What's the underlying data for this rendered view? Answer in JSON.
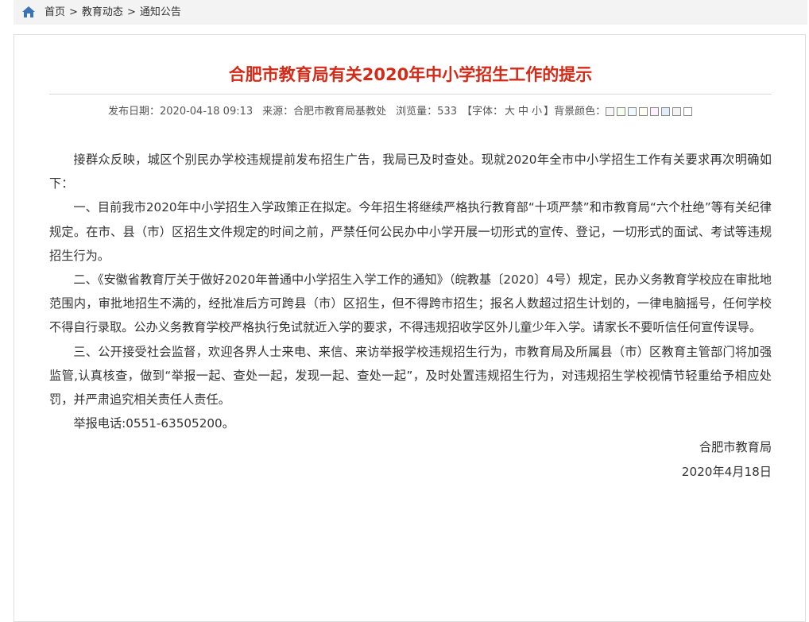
{
  "breadcrumb": {
    "home": "首页",
    "section": "教育动态",
    "current": "通知公告",
    "separator": ">"
  },
  "article": {
    "title": "合肥市教育局有关2020年中小学招生工作的提示",
    "meta": {
      "publish_date": "发布日期：2020-04-18 09:13",
      "source": "来源：合肥市教育局基教处",
      "views": "浏览量：533",
      "font_prefix": "【字体：",
      "font_large": "大",
      "font_medium": "中",
      "font_small": "小",
      "font_suffix": "】",
      "bg_color_label": "背景颜色：",
      "bg_swatches": [
        "#f7f7f7",
        "#f5fff0",
        "#eefaff",
        "#fffdf0",
        "#fdf0ff",
        "#e3ecf9",
        "#f3f3f3",
        "#ffffff"
      ]
    },
    "paragraphs": [
      "接群众反映，城区个别民办学校违规提前发布招生广告，我局已及时查处。现就2020年全市中小学招生工作有关要求再次明确如下：",
      "一、目前我市2020年中小学招生入学政策正在拟定。今年招生将继续严格执行教育部“十项严禁”和市教育局“六个杜绝”等有关纪律规定。在市、县（市）区招生文件规定的时间之前，严禁任何公民办中小学开展一切形式的宣传、登记，一切形式的面试、考试等违规招生行为。",
      "二、《安徽省教育厅关于做好2020年普通中小学招生入学工作的通知》（皖教基〔2020〕4号）规定，民办义务教育学校应在审批地范围内，审批地招生不满的，经批准后方可跨县（市）区招生，但不得跨市招生；报名人数超过招生计划的，一律电脑摇号，任何学校不得自行录取。公办义务教育学校严格执行免试就近入学的要求，不得违规招收学区外儿童少年入学。请家长不要听信任何宣传误导。",
      "三、公开接受社会监督，欢迎各界人士来电、来信、来访举报学校违规招生行为，市教育局及所属县（市）区教育主管部门将加强监管,认真核查，做到“举报一起、查处一起，发现一起、查处一起”，及时处置违规招生行为，对违规招生学校视情节轻重给予相应处罚，并严肃追究相关责任人责任。",
      "举报电话:0551-63505200。"
    ],
    "signature": "合肥市教育局",
    "date": "2020年4月18日"
  },
  "colors": {
    "title": "#d42a18",
    "home_icon": "#3a73b8"
  }
}
